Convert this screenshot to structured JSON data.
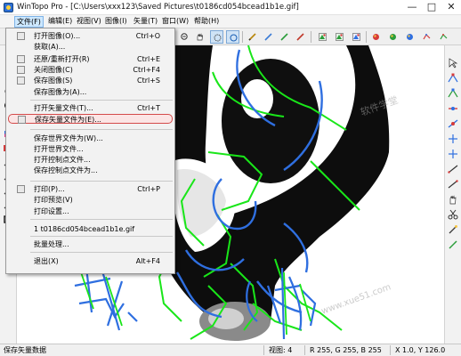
{
  "window": {
    "title": "WinTopo Pro - [C:\\Users\\xxx123\\Saved Pictures\\t0186cd054bcead1b1e.gif]",
    "controls": {
      "minimize": "—",
      "maximize": "□",
      "close": "✕"
    }
  },
  "menubar": {
    "items": [
      {
        "label": "文件(F)"
      },
      {
        "label": "编辑(E)"
      },
      {
        "label": "视图(V)"
      },
      {
        "label": "图像(I)"
      },
      {
        "label": "矢量(T)"
      },
      {
        "label": "窗口(W)"
      },
      {
        "label": "帮助(H)"
      }
    ]
  },
  "file_menu": {
    "items": [
      {
        "label": "打开图像(O)...",
        "shortcut": "Ctrl+O"
      },
      {
        "label": "获取(A)...",
        "shortcut": ""
      },
      {
        "label": "还原/重新打开(R)",
        "shortcut": "Ctrl+E"
      },
      {
        "label": "关闭图像(C)",
        "shortcut": "Ctrl+F4"
      },
      {
        "label": "保存图像(S)",
        "shortcut": "Ctrl+S"
      },
      {
        "label": "保存图像为(A)...",
        "shortcut": ""
      },
      {
        "label": "打开矢量文件(T)...",
        "shortcut": "Ctrl+T"
      },
      {
        "label": "保存矢量文件为(E)...",
        "shortcut": ""
      },
      {
        "label": "保存世界文件为(W)...",
        "shortcut": ""
      },
      {
        "label": "打开世界文件...",
        "shortcut": ""
      },
      {
        "label": "打开控制点文件...",
        "shortcut": ""
      },
      {
        "label": "保存控制点文件为...",
        "shortcut": ""
      },
      {
        "label": "打印(P)...",
        "shortcut": "Ctrl+P"
      },
      {
        "label": "打印预览(V)",
        "shortcut": ""
      },
      {
        "label": "打印设置...",
        "shortcut": ""
      },
      {
        "label": "1 t0186cd054bcead1b1e.gif",
        "shortcut": ""
      },
      {
        "label": "批量处理...",
        "shortcut": ""
      },
      {
        "label": "退出(X)",
        "shortcut": "Alt+F4"
      }
    ],
    "highlighted": "保存矢量文件为(E)..."
  },
  "canvas": {
    "handwriting_left": "我",
    "handwriting_right": "吼"
  },
  "watermark": {
    "line1": "软件学堂",
    "line2": "www.xue51.com"
  },
  "statusbar": {
    "message": "保存矢量数据",
    "zoom": "视图: 4",
    "color": "R 255, G 255, B 255",
    "coords": "X 1.0, Y 126.0"
  },
  "colors": {
    "vector_green": "#19e619",
    "vector_blue": "#2f6fe0",
    "image_dark": "#0d0d0d",
    "highlight_border": "#d44a4a"
  }
}
